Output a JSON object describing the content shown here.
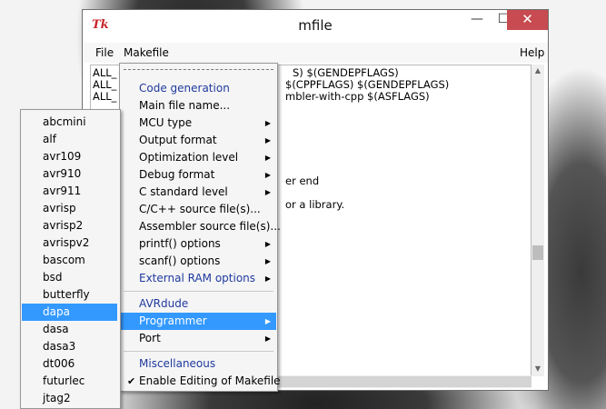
{
  "window": {
    "title": "mfile",
    "icon": "tk-icon",
    "controls": {
      "minimize": "—",
      "maximize": "☐",
      "close": "✕"
    }
  },
  "menubar": {
    "file": "File",
    "makefile": "Makefile",
    "help": "Help"
  },
  "editor": {
    "lines": [
      "ALL_",
      "ALL_",
      "ALL_",
      "S) $(GENDEPFLAGS)",
      "$(CPPFLAGS) $(GENDEPFLAGS)",
      "mbler-with-cpp $(ASFLAGS)",
      "er end",
      "or a library."
    ]
  },
  "makefile_menu": {
    "items": [
      {
        "label": "Code generation",
        "type": "heading"
      },
      {
        "label": "Main file name..."
      },
      {
        "label": "MCU type",
        "submenu": true
      },
      {
        "label": "Output format",
        "submenu": true
      },
      {
        "label": "Optimization level",
        "submenu": true
      },
      {
        "label": "Debug format",
        "submenu": true
      },
      {
        "label": "C standard level",
        "submenu": true
      },
      {
        "label": "C/C++ source file(s)..."
      },
      {
        "label": "Assembler source file(s)..."
      },
      {
        "label": "printf() options",
        "submenu": true
      },
      {
        "label": "scanf() options",
        "submenu": true
      },
      {
        "label": "External RAM options",
        "submenu": true,
        "type": "heading"
      },
      {
        "label": "AVRdude",
        "type": "heading"
      },
      {
        "label": "Programmer",
        "submenu": true,
        "selected": true
      },
      {
        "label": "Port",
        "submenu": true
      },
      {
        "label": "Miscellaneous",
        "type": "heading"
      },
      {
        "label": "Enable Editing of Makefile",
        "checked": true
      }
    ]
  },
  "programmer_menu": {
    "items": [
      "abcmini",
      "alf",
      "avr109",
      "avr910",
      "avr911",
      "avrisp",
      "avrisp2",
      "avrispv2",
      "bascom",
      "bsd",
      "butterfly",
      "dapa",
      "dasa",
      "dasa3",
      "dt006",
      "futurlec",
      "jtag2"
    ],
    "selected": "dapa"
  },
  "colors": {
    "highlight": "#3399ff",
    "heading": "#1f3a9e",
    "close": "#c74b50"
  }
}
